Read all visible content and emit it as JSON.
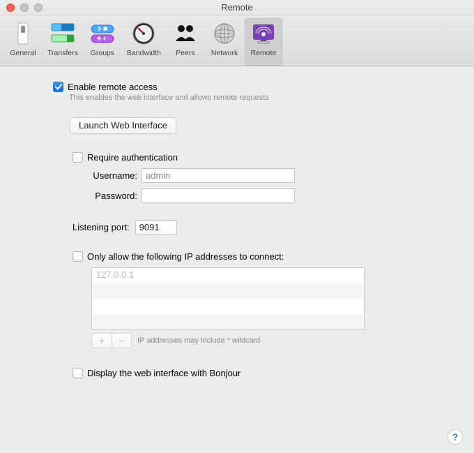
{
  "window": {
    "title": "Remote"
  },
  "toolbar": {
    "items": [
      {
        "label": "General"
      },
      {
        "label": "Transfers"
      },
      {
        "label": "Groups"
      },
      {
        "label": "Bandwidth"
      },
      {
        "label": "Peers"
      },
      {
        "label": "Network"
      },
      {
        "label": "Remote"
      }
    ],
    "selected_index": 6
  },
  "enable": {
    "checked": true,
    "label": "Enable remote access",
    "desc": "This enables the web interface and allows remote requests"
  },
  "buttons": {
    "launch_web": "Launch Web Interface"
  },
  "auth": {
    "checked": false,
    "require_label": "Require authentication",
    "username_label": "Username:",
    "username_value": "admin",
    "password_label": "Password:",
    "password_value": ""
  },
  "port": {
    "label": "Listening port:",
    "value": "9091"
  },
  "ips": {
    "checked": false,
    "label": "Only allow the following IP addresses to connect:",
    "list": [
      "127.0.0.1"
    ],
    "hint": "IP addresses may include * wildcard",
    "add": "+",
    "remove": "−"
  },
  "bonjour": {
    "checked": false,
    "label": "Display the web interface with Bonjour"
  },
  "help": {
    "label": "?"
  }
}
